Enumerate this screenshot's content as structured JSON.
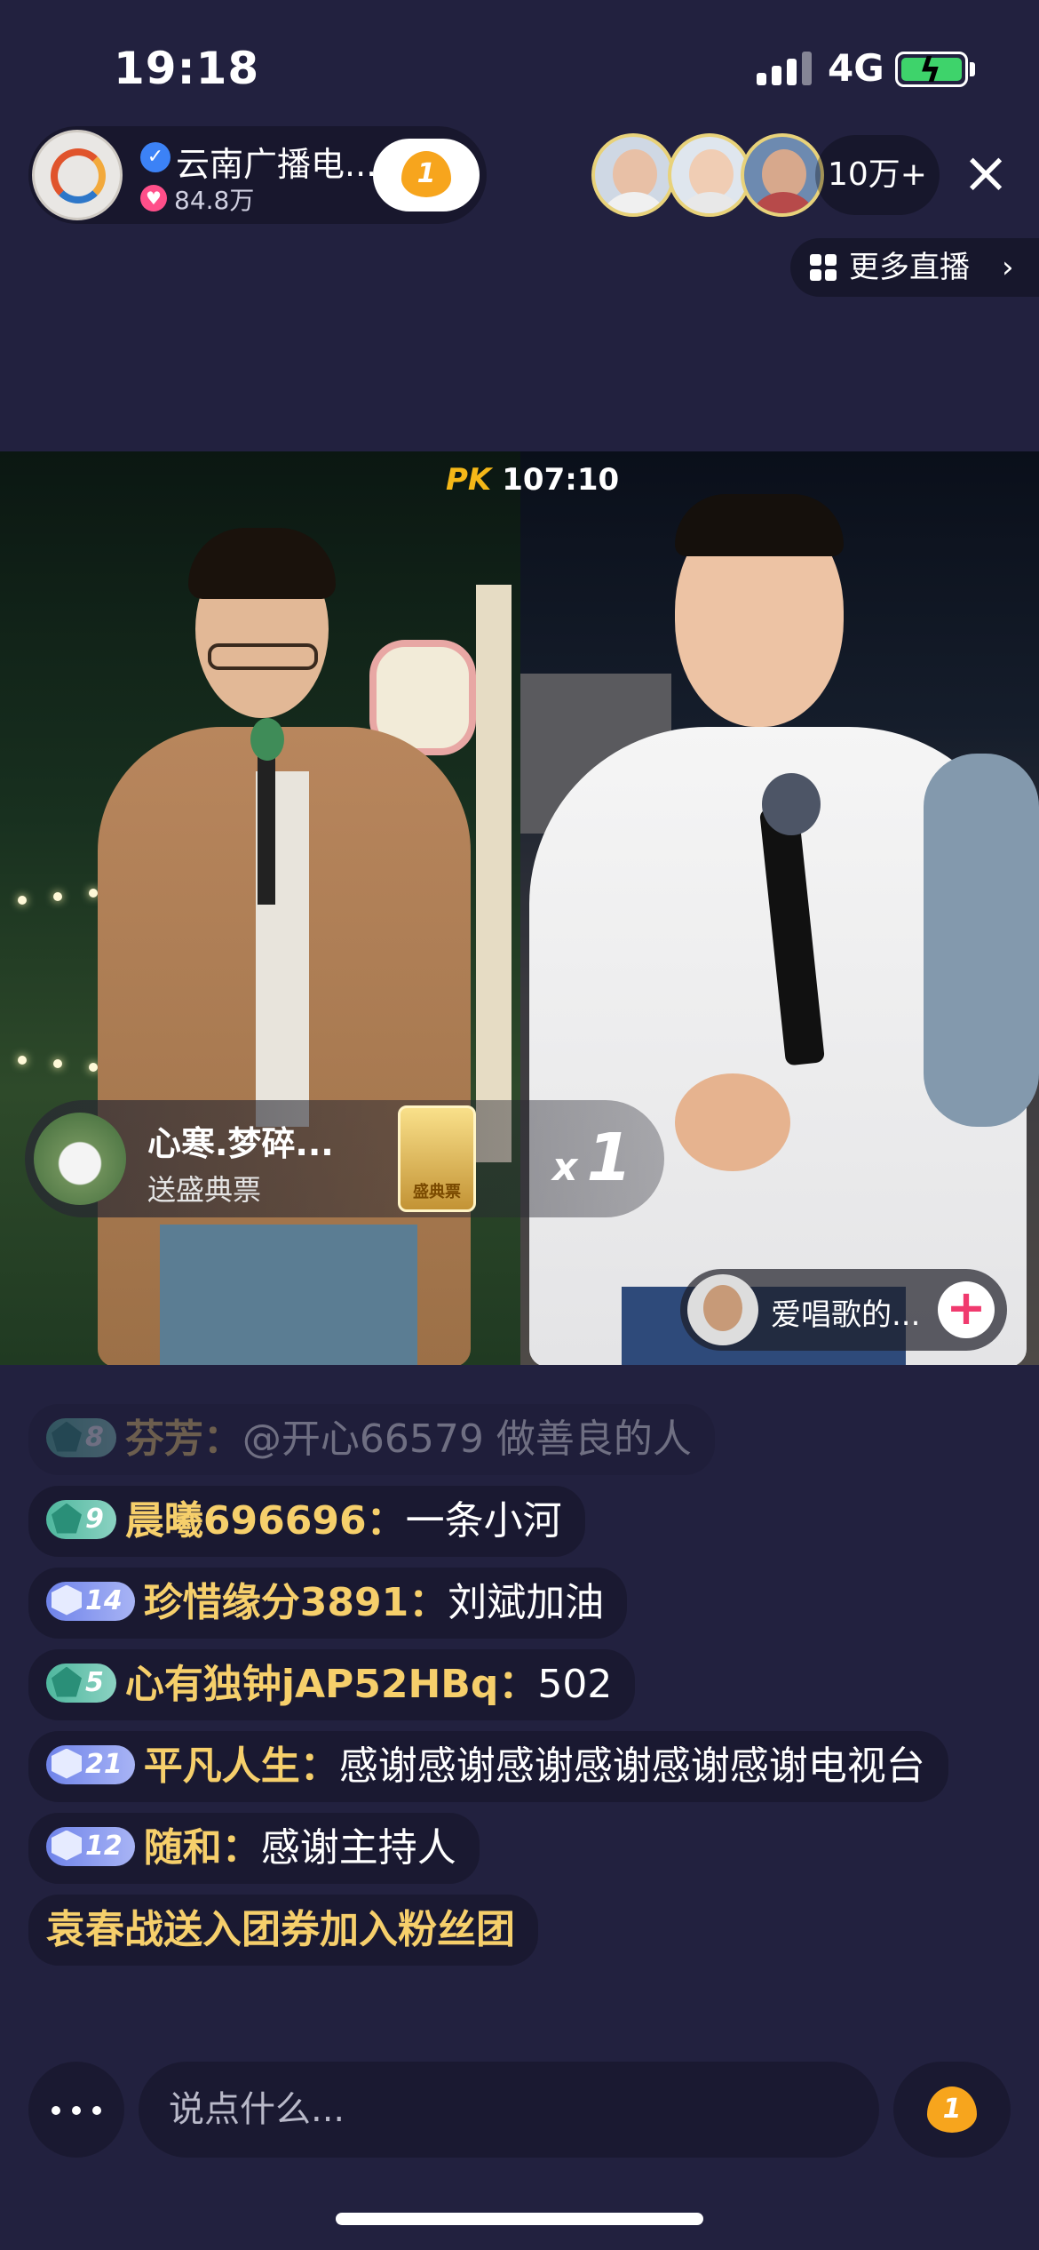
{
  "status": {
    "time": "19:18",
    "network": "4G"
  },
  "host": {
    "name": "云南广播电...",
    "likes": "84.8万",
    "fan_level": "1"
  },
  "viewers": {
    "count": "10万+"
  },
  "nav": {
    "more_live": "更多直播",
    "close": "×"
  },
  "pk": {
    "label": "PK",
    "timer": "107:10"
  },
  "gift": {
    "user": "心寒.梦碎...",
    "action": "送盛典票",
    "item_label": "盛典票",
    "count_prefix": "x",
    "count": "1"
  },
  "opponent": {
    "name": "爱唱歌的...",
    "add": "+"
  },
  "comments": [
    {
      "level": "8",
      "tier": "teal",
      "user": "芬芳：",
      "text": "@开心66579 做善良的人",
      "faded": true
    },
    {
      "level": "9",
      "tier": "teal",
      "user": "晨曦696696：",
      "text": "一条小河",
      "faded": false
    },
    {
      "level": "14",
      "tier": "blue",
      "user": "珍惜缘分3891：",
      "text": "刘斌加油",
      "faded": false
    },
    {
      "level": "5",
      "tier": "teal",
      "user": "心有独钟jAP52HBq：",
      "text": "502",
      "faded": false
    },
    {
      "level": "21",
      "tier": "blue",
      "user": "平凡人生：",
      "text": "感谢感谢感谢感谢感谢感谢电视台",
      "faded": false
    },
    {
      "level": "12",
      "tier": "blue",
      "user": "随和：",
      "text": "感谢主持人",
      "faded": false
    }
  ],
  "system_message": "袁春战送入团券加入粉丝团",
  "input": {
    "placeholder": "说点什么..."
  },
  "colors": {
    "background": "#22213f",
    "username": "#f6cf6b",
    "pk_logo": "#f5b818",
    "add_button": "#f03a6e"
  }
}
